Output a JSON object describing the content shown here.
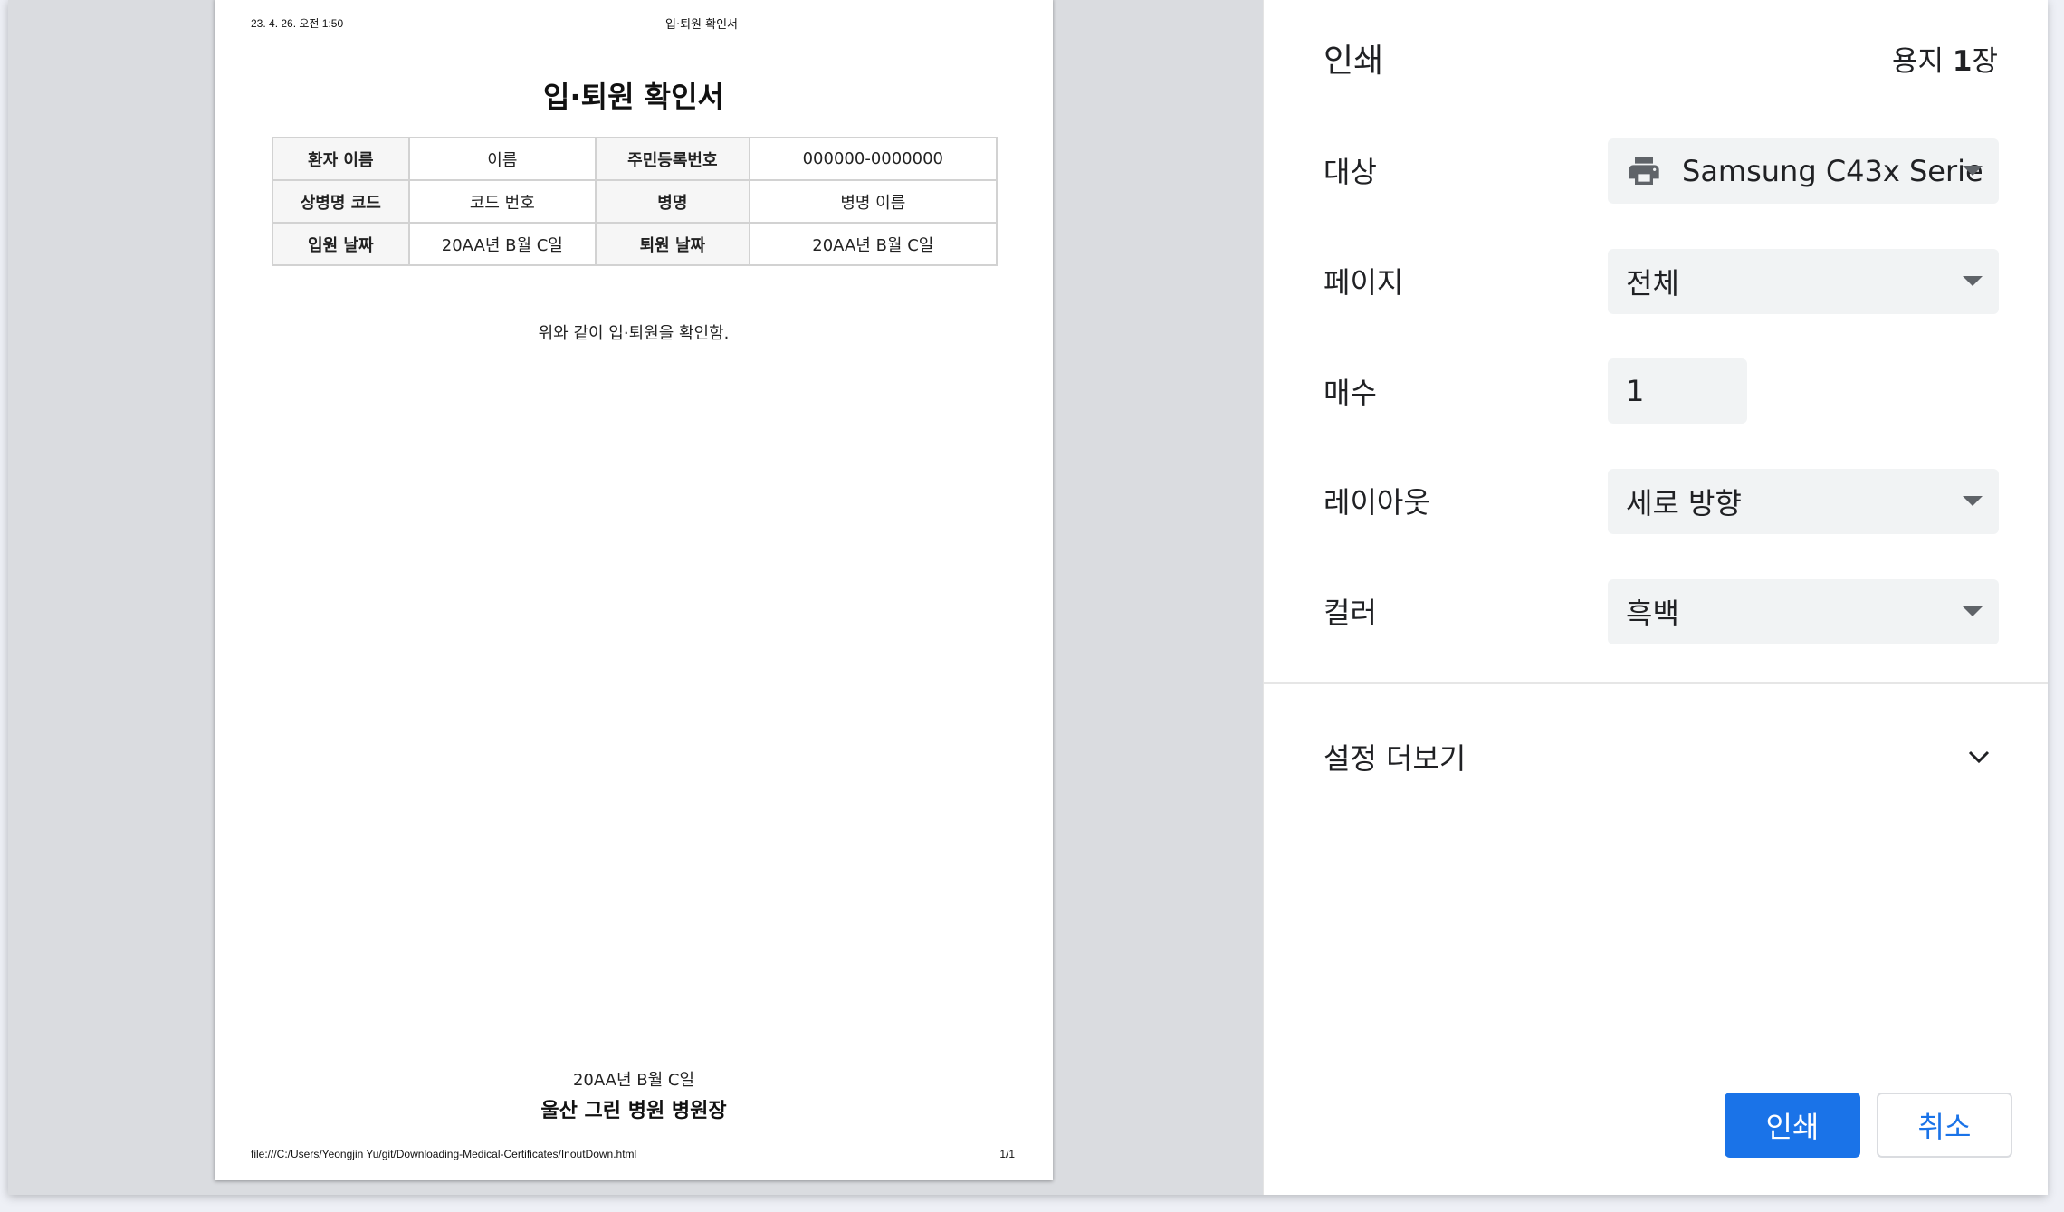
{
  "preview": {
    "header_date": "23. 4. 26. 오전 1:50",
    "header_title": "입·퇴원 확인서",
    "document_title": "입·퇴원 확인서",
    "table": [
      [
        "환자 이름",
        "이름",
        "주민등록번호",
        "000000-0000000"
      ],
      [
        "상병명 코드",
        "코드 번호",
        "병명",
        "병명 이름"
      ],
      [
        "입원 날짜",
        "20AA년 B월 C일",
        "퇴원 날짜",
        "20AA년 B월 C일"
      ]
    ],
    "confirm_text": "위와 같이 입·퇴원을 확인함.",
    "sign_date": "20AA년 B월 C일",
    "sign_org": "울산 그린 병원 병원장",
    "footer_path": "file:///C:/Users/Yeongjin Yu/git/Downloading-Medical-Certificates/InoutDown.html",
    "footer_page": "1/1"
  },
  "settings": {
    "title": "인쇄",
    "sheets_prefix": "용지 ",
    "sheets_count": "1",
    "sheets_suffix": "장",
    "destination_label": "대상",
    "destination_value": "Samsung C43x Serie",
    "destination_icon": "printer-icon",
    "pages_label": "페이지",
    "pages_value": "전체",
    "copies_label": "매수",
    "copies_value": "1",
    "layout_label": "레이아웃",
    "layout_value": "세로 방향",
    "color_label": "컬러",
    "color_value": "흑백",
    "more_settings": "설정 더보기",
    "print_button": "인쇄",
    "cancel_button": "취소"
  },
  "colors": {
    "primary": "#1a73e8",
    "preview_background": "#dadce0",
    "field_background": "#f1f3f4"
  }
}
